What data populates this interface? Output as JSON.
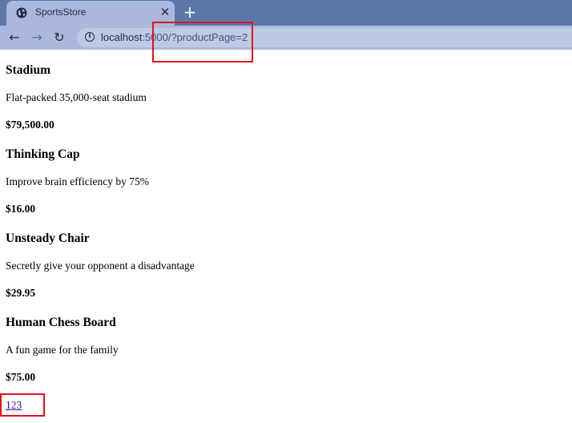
{
  "browser": {
    "tab_title": "SportsStore",
    "url_host": "localhost",
    "url_rest": ":5000/?productPage=2",
    "icons": {
      "tab": "globe-icon",
      "close": "close-icon",
      "new_tab": "plus-icon",
      "back": "back-arrow-icon",
      "forward": "forward-arrow-icon",
      "reload": "reload-icon",
      "site_info": "info-icon"
    },
    "colors": {
      "tabstrip": "#5b78a8",
      "toolbar": "#a9b8dc",
      "omnibox": "#bccae6"
    }
  },
  "products": [
    {
      "name": "Stadium",
      "description": "Flat-packed 35,000-seat stadium",
      "price": "$79,500.00"
    },
    {
      "name": "Thinking Cap",
      "description": "Improve brain efficiency by 75%",
      "price": "$16.00"
    },
    {
      "name": "Unsteady Chair",
      "description": "Secretly give your opponent a disadvantage",
      "price": "$29.95"
    },
    {
      "name": "Human Chess Board",
      "description": "A fun game for the family",
      "price": "$75.00"
    }
  ],
  "pagination": {
    "pages": [
      "1",
      "2",
      "3"
    ],
    "current": "2"
  },
  "annotations": {
    "highlight_color": "#e3101a"
  }
}
